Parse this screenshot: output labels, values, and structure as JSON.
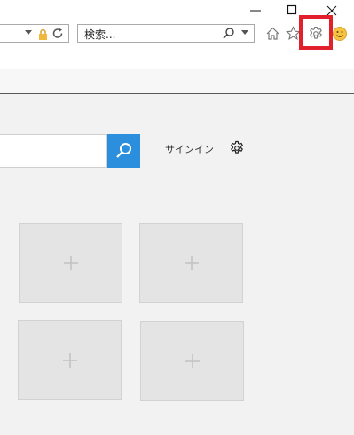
{
  "window": {
    "controls": [
      "minimize-icon",
      "maximize-icon",
      "close-icon"
    ]
  },
  "toolbar": {
    "address_icons": [
      "chevron-down-icon",
      "lock-icon",
      "refresh-icon"
    ],
    "search": {
      "placeholder": "検索...",
      "icons": [
        "search-icon",
        "chevron-down-icon"
      ]
    },
    "right_icons": [
      "home-icon",
      "star-icon",
      "gear-icon",
      "smiley-icon"
    ],
    "highlight_color": "#e2202c"
  },
  "page": {
    "search_button_color": "#2b8fdd",
    "signin_label": "サインイン",
    "settings_icon": "gear-icon",
    "tiles": [
      {
        "icon": "plus-icon"
      },
      {
        "icon": "plus-icon"
      },
      {
        "icon": "plus-icon"
      },
      {
        "icon": "plus-icon"
      }
    ]
  }
}
